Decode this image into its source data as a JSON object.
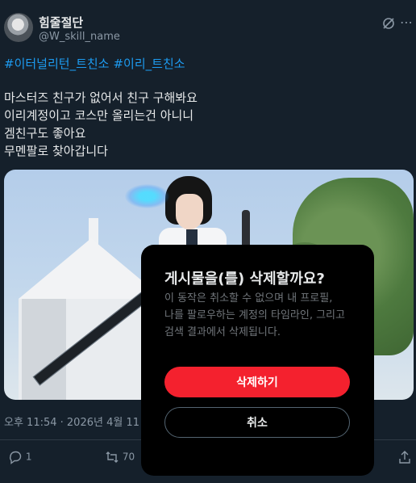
{
  "post": {
    "display_name": "힘줄절단",
    "handle": "@W_skill_name",
    "hashtags": [
      "#이터널리턴_트친소",
      "#이리_트친소"
    ],
    "body_lines": [
      "마스터즈 친구가 없어서 친구 구해봐요",
      "이리계정이고 코스만 올리는건 아니니",
      "겜친구도 좋아요",
      "무멘팔로 찾아갑니다"
    ],
    "timestamp": "오후 11:54 · 2026년 4월 11",
    "reply_count": "1",
    "repost_count": "70"
  },
  "dialog": {
    "title": "게시물을(를) 삭제할까요?",
    "description": "이 동작은 취소할 수 없으며 내 프로필, 나를 팔로우하는 계정의 타임라인, 그리고 검색 결과에서 삭제됩니다.",
    "delete_label": "삭제하기",
    "cancel_label": "취소"
  },
  "colors": {
    "background": "#15202b",
    "accent": "#1d9bf0",
    "danger": "#f4212e",
    "dialog_bg": "#000000"
  },
  "icons": [
    "grok-icon",
    "more-icon",
    "reply-icon",
    "repost-icon",
    "like-icon",
    "bookmark-icon",
    "share-icon"
  ]
}
